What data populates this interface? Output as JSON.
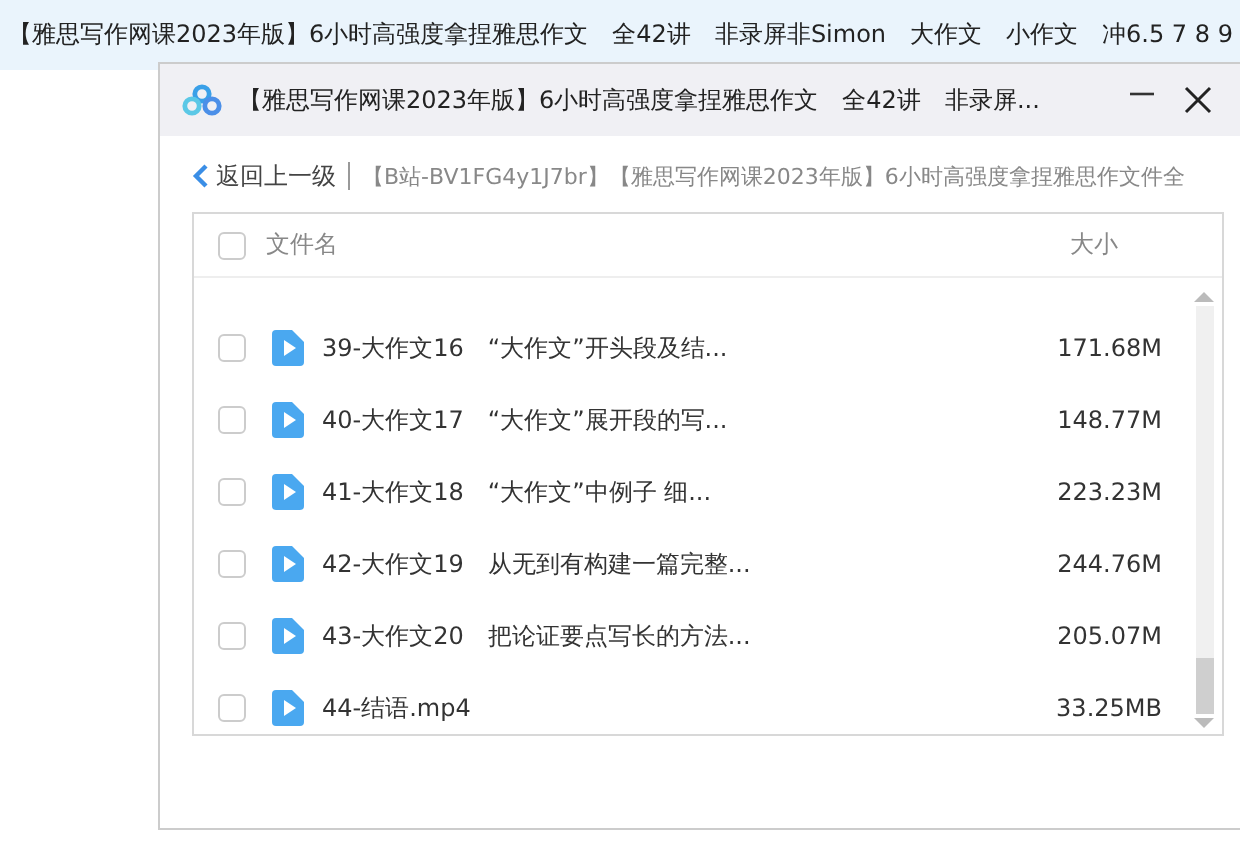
{
  "background_title": "【雅思写作网课2023年版】6小时高强度拿捏雅思作文　全42讲　非录屏非Simon　大作文　小作文　冲6.5 7 8 9",
  "window": {
    "title": "【雅思写作网课2023年版】6小时高强度拿捏雅思作文　全42讲　非录屏..."
  },
  "breadcrumb": {
    "back": "返回上一级",
    "path": "【B站-BV1FG4y1J7br】【雅思写作网课2023年版】6小时高强度拿捏雅思作文件全"
  },
  "table": {
    "select_all_checked": false,
    "columns": [
      "文件名",
      "大小"
    ],
    "rows": [
      {
        "name": "39-大作文16　“大作文”开头段及结...",
        "size": "171.68M",
        "checked": false
      },
      {
        "name": "40-大作文17　“大作文”展开段的写...",
        "size": "148.77M",
        "checked": false
      },
      {
        "name": "41-大作文18　“大作文”中例子 细...",
        "size": "223.23M",
        "checked": false
      },
      {
        "name": "42-大作文19　从无到有构建一篇完整...",
        "size": "244.76M",
        "checked": false
      },
      {
        "name": "43-大作文20　把论证要点写长的方法...",
        "size": "205.07M",
        "checked": false
      },
      {
        "name": "44-结语.mp4",
        "size": "33.25MB",
        "checked": false
      }
    ]
  }
}
